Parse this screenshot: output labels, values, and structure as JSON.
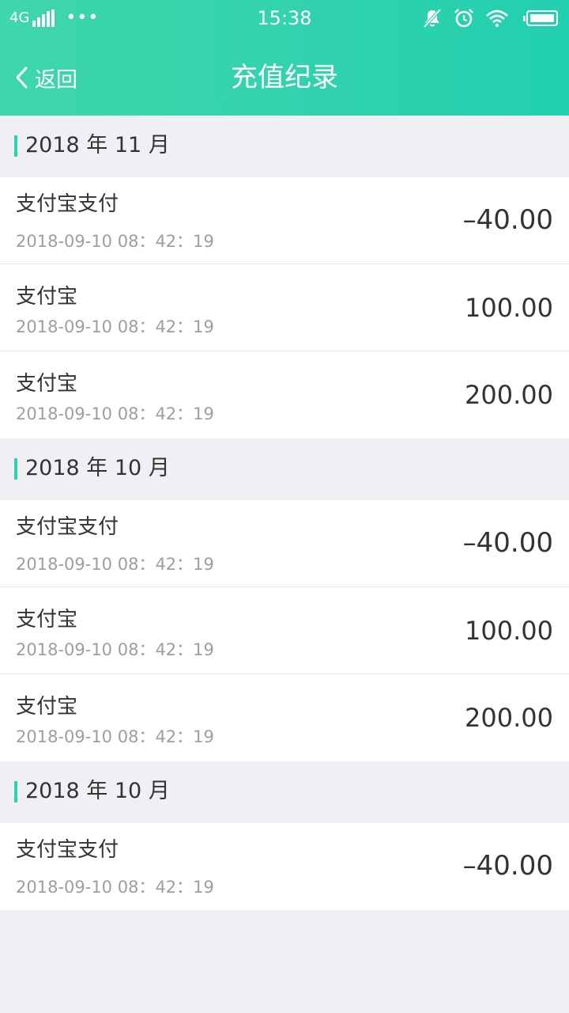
{
  "status_bar": {
    "network": "4G",
    "more": "•••",
    "time": "15:38",
    "icons": [
      "mute-icon",
      "alarm-icon",
      "wifi-icon",
      "battery-icon"
    ]
  },
  "nav": {
    "back_label": "返回",
    "title": "充值纪录"
  },
  "colors": {
    "header_start": "#3fd6ac",
    "header_end": "#21cfae",
    "accent": "#2fd2ad",
    "page_bg": "#efeff4"
  },
  "groups": [
    {
      "month": "2018 年 11 月",
      "records": [
        {
          "title": "支付宝支付",
          "time": "2018-09-10  08：42：19",
          "amount": "–40.00",
          "kind": "pay"
        },
        {
          "title": "支付宝",
          "time": "2018-09-10 08：42：19",
          "amount": "100.00",
          "kind": "rc"
        },
        {
          "title": "支付宝",
          "time": "2018-09-10 08：42：19",
          "amount": "200.00",
          "kind": "rc"
        }
      ]
    },
    {
      "month": "2018 年 10 月",
      "records": [
        {
          "title": "支付宝支付",
          "time": "2018-09-10  08：42：19",
          "amount": "–40.00",
          "kind": "pay"
        },
        {
          "title": "支付宝",
          "time": "2018-09-10 08：42：19",
          "amount": "100.00",
          "kind": "rc"
        },
        {
          "title": "支付宝",
          "time": "2018-09-10 08：42：19",
          "amount": "200.00",
          "kind": "rc"
        }
      ]
    },
    {
      "month": "2018 年 10 月",
      "records": [
        {
          "title": "支付宝支付",
          "time": "2018-09-10  08：42：19",
          "amount": "–40.00",
          "kind": "pay"
        }
      ]
    }
  ]
}
